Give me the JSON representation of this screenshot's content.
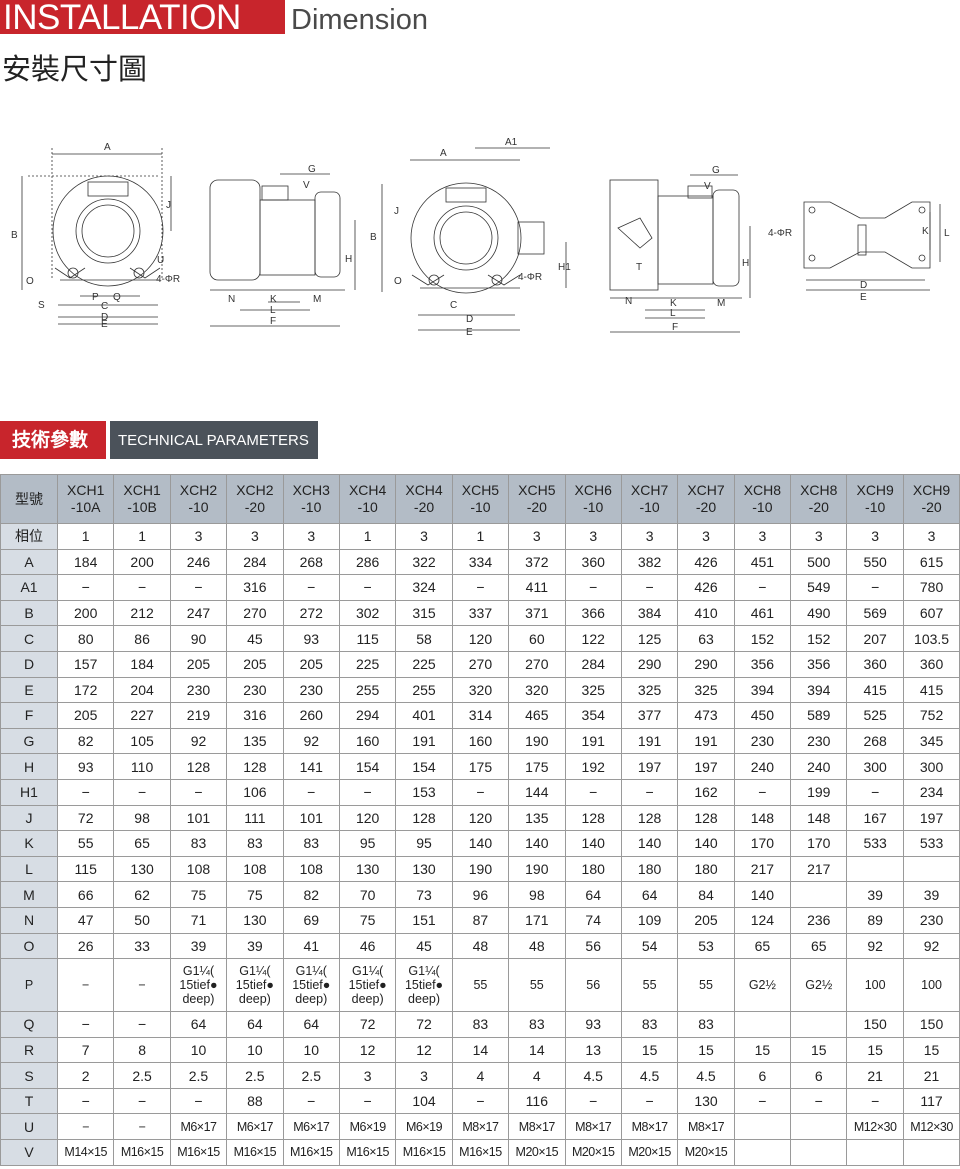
{
  "header": {
    "title_red": "INSTALLATION",
    "title_dim": "Dimension",
    "subtitle": "安裝尺寸圖"
  },
  "section": {
    "label_cn": "技術參數",
    "label_en": "TECHNICAL PARAMETERS"
  },
  "diagram_labels": {
    "d1": [
      "A",
      "J",
      "B",
      "O",
      "S",
      "P",
      "Q",
      "C",
      "D",
      "E",
      "U",
      "4-ΦR"
    ],
    "d2": [
      "G",
      "V",
      "H",
      "N",
      "K",
      "L",
      "M",
      "F"
    ],
    "d3": [
      "A",
      "A1",
      "J",
      "B",
      "H1",
      "O",
      "C",
      "4-ΦR",
      "D",
      "E"
    ],
    "d4": [
      "G",
      "V",
      "T",
      "H",
      "N",
      "K",
      "L",
      "M",
      "F"
    ],
    "d5": [
      "4-ΦR",
      "K",
      "L",
      "D",
      "E"
    ]
  },
  "table": {
    "corner": "型號",
    "models": [
      [
        "XCH1",
        "-10A"
      ],
      [
        "XCH1",
        "-10B"
      ],
      [
        "XCH2",
        "-10"
      ],
      [
        "XCH2",
        "-20"
      ],
      [
        "XCH3",
        "-10"
      ],
      [
        "XCH4",
        "-10"
      ],
      [
        "XCH4",
        "-20"
      ],
      [
        "XCH5",
        "-10"
      ],
      [
        "XCH5",
        "-20"
      ],
      [
        "XCH6",
        "-10"
      ],
      [
        "XCH7",
        "-10"
      ],
      [
        "XCH7",
        "-20"
      ],
      [
        "XCH8",
        "-10"
      ],
      [
        "XCH8",
        "-20"
      ],
      [
        "XCH9",
        "-10"
      ],
      [
        "XCH9",
        "-20"
      ]
    ],
    "rows": [
      {
        "label": "相位",
        "values": [
          "1",
          "1",
          "3",
          "3",
          "3",
          "1",
          "3",
          "1",
          "3",
          "3",
          "3",
          "3",
          "3",
          "3",
          "3",
          "3"
        ]
      },
      {
        "label": "A",
        "values": [
          "184",
          "200",
          "246",
          "284",
          "268",
          "286",
          "322",
          "334",
          "372",
          "360",
          "382",
          "426",
          "451",
          "500",
          "550",
          "615"
        ]
      },
      {
        "label": "A1",
        "values": [
          "−",
          "−",
          "−",
          "316",
          "−",
          "−",
          "324",
          "−",
          "411",
          "−",
          "−",
          "426",
          "−",
          "549",
          "−",
          "780"
        ]
      },
      {
        "label": "B",
        "values": [
          "200",
          "212",
          "247",
          "270",
          "272",
          "302",
          "315",
          "337",
          "371",
          "366",
          "384",
          "410",
          "461",
          "490",
          "569",
          "607"
        ]
      },
      {
        "label": "C",
        "values": [
          "80",
          "86",
          "90",
          "45",
          "93",
          "115",
          "58",
          "120",
          "60",
          "122",
          "125",
          "63",
          "152",
          "152",
          "207",
          "103.5"
        ]
      },
      {
        "label": "D",
        "values": [
          "157",
          "184",
          "205",
          "205",
          "205",
          "225",
          "225",
          "270",
          "270",
          "284",
          "290",
          "290",
          "356",
          "356",
          "360",
          "360"
        ]
      },
      {
        "label": "E",
        "values": [
          "172",
          "204",
          "230",
          "230",
          "230",
          "255",
          "255",
          "320",
          "320",
          "325",
          "325",
          "325",
          "394",
          "394",
          "415",
          "415"
        ]
      },
      {
        "label": "F",
        "values": [
          "205",
          "227",
          "219",
          "316",
          "260",
          "294",
          "401",
          "314",
          "465",
          "354",
          "377",
          "473",
          "450",
          "589",
          "525",
          "752"
        ]
      },
      {
        "label": "G",
        "values": [
          "82",
          "105",
          "92",
          "135",
          "92",
          "160",
          "191",
          "160",
          "190",
          "191",
          "191",
          "191",
          "230",
          "230",
          "268",
          "345"
        ]
      },
      {
        "label": "H",
        "values": [
          "93",
          "110",
          "128",
          "128",
          "141",
          "154",
          "154",
          "175",
          "175",
          "192",
          "197",
          "197",
          "240",
          "240",
          "300",
          "300"
        ]
      },
      {
        "label": "H1",
        "values": [
          "−",
          "−",
          "−",
          "106",
          "−",
          "−",
          "153",
          "−",
          "144",
          "−",
          "−",
          "162",
          "−",
          "199",
          "−",
          "234"
        ]
      },
      {
        "label": "J",
        "values": [
          "72",
          "98",
          "101",
          "111",
          "101",
          "120",
          "128",
          "120",
          "135",
          "128",
          "128",
          "128",
          "148",
          "148",
          "167",
          "197"
        ]
      },
      {
        "label": "K",
        "values": [
          "55",
          "65",
          "83",
          "83",
          "83",
          "95",
          "95",
          "140",
          "140",
          "140",
          "140",
          "140",
          "170",
          "170",
          "533",
          "533"
        ]
      },
      {
        "label": "L",
        "values": [
          "115",
          "130",
          "108",
          "108",
          "108",
          "130",
          "130",
          "190",
          "190",
          "180",
          "180",
          "180",
          "217",
          "217",
          "",
          ""
        ]
      },
      {
        "label": "M",
        "values": [
          "66",
          "62",
          "75",
          "75",
          "82",
          "70",
          "73",
          "96",
          "98",
          "64",
          "64",
          "84",
          "140",
          "",
          "39",
          "39"
        ]
      },
      {
        "label": "N",
        "values": [
          "47",
          "50",
          "71",
          "130",
          "69",
          "75",
          "151",
          "87",
          "171",
          "74",
          "109",
          "205",
          "124",
          "236",
          "89",
          "230"
        ]
      },
      {
        "label": "O",
        "values": [
          "26",
          "33",
          "39",
          "39",
          "41",
          "46",
          "45",
          "48",
          "48",
          "56",
          "54",
          "53",
          "65",
          "65",
          "92",
          "92"
        ]
      },
      {
        "label": "P",
        "tall": true,
        "values": [
          "−",
          "−",
          "G1¼( 15tief● deep)",
          "G1¼( 15tief● deep)",
          "G1¼( 15tief● deep)",
          "G1¼( 15tief● deep)",
          "G1¼( 15tief● deep)",
          "55",
          "55",
          "56",
          "55",
          "55",
          "G2½",
          "G2½",
          "100",
          "100"
        ]
      },
      {
        "label": "Q",
        "values": [
          "−",
          "−",
          "64",
          "64",
          "64",
          "72",
          "72",
          "83",
          "83",
          "93",
          "83",
          "83",
          "",
          "",
          "150",
          "150"
        ]
      },
      {
        "label": "R",
        "values": [
          "7",
          "8",
          "10",
          "10",
          "10",
          "12",
          "12",
          "14",
          "14",
          "13",
          "15",
          "15",
          "15",
          "15",
          "15",
          "15"
        ]
      },
      {
        "label": "S",
        "values": [
          "2",
          "2.5",
          "2.5",
          "2.5",
          "2.5",
          "3",
          "3",
          "4",
          "4",
          "4.5",
          "4.5",
          "4.5",
          "6",
          "6",
          "21",
          "21"
        ]
      },
      {
        "label": "T",
        "values": [
          "−",
          "−",
          "−",
          "88",
          "−",
          "−",
          "104",
          "−",
          "116",
          "−",
          "−",
          "130",
          "−",
          "−",
          "−",
          "117"
        ]
      },
      {
        "label": "U",
        "small": true,
        "values": [
          "−",
          "−",
          "M6×17",
          "M6×17",
          "M6×17",
          "M6×19",
          "M6×19",
          "M8×17",
          "M8×17",
          "M8×17",
          "M8×17",
          "M8×17",
          "",
          "",
          "M12×30",
          "M12×30"
        ]
      },
      {
        "label": "V",
        "small": true,
        "values": [
          "M14×15",
          "M16×15",
          "M16×15",
          "M16×15",
          "M16×15",
          "M16×15",
          "M16×15",
          "M16×15",
          "M20×15",
          "M20×15",
          "M20×15",
          "M20×15",
          "",
          "",
          "",
          ""
        ]
      }
    ]
  }
}
